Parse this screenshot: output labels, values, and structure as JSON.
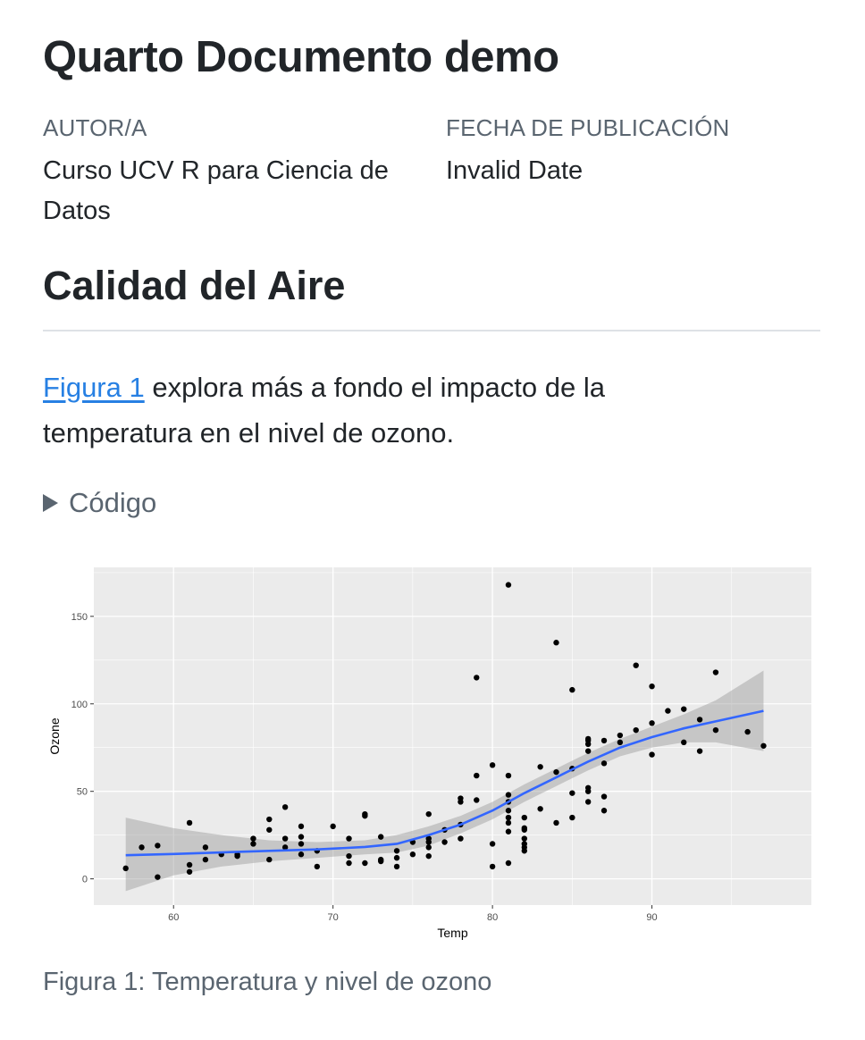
{
  "document": {
    "title": "Quarto Documento demo",
    "author_label": "AUTOR/A",
    "author": "Curso UCV R para Ciencia de Datos",
    "date_label": "FECHA DE PUBLICACIÓN",
    "date": "Invalid Date"
  },
  "section": {
    "title": "Calidad del Aire",
    "link_text": "Figura 1",
    "body_text": " explora más a fondo el impacto de la temperatura en el nivel de ozono.",
    "code_toggle": "Código"
  },
  "figure": {
    "caption": "Figura 1: Temperatura y nivel de ozono"
  },
  "colors": {
    "panel": "#ebebeb",
    "grid": "#ffffff",
    "points": "#000000",
    "smooth_line": "#3366ff",
    "ribbon": "#999999",
    "link": "#2780e3"
  },
  "chart_data": {
    "type": "scatter",
    "xlabel": "Temp",
    "ylabel": "Ozone",
    "xlim": [
      55,
      100
    ],
    "ylim": [
      -15,
      178
    ],
    "xticks": [
      60,
      70,
      80,
      90
    ],
    "yticks": [
      0,
      50,
      100,
      150
    ],
    "grid": true,
    "points": [
      [
        57,
        6
      ],
      [
        58,
        18
      ],
      [
        59,
        19
      ],
      [
        59,
        1
      ],
      [
        61,
        8
      ],
      [
        61,
        4
      ],
      [
        61,
        32
      ],
      [
        62,
        11
      ],
      [
        62,
        18
      ],
      [
        63,
        14
      ],
      [
        64,
        13
      ],
      [
        64,
        14
      ],
      [
        65,
        20
      ],
      [
        65,
        23
      ],
      [
        66,
        11
      ],
      [
        66,
        28
      ],
      [
        66,
        34
      ],
      [
        67,
        41
      ],
      [
        67,
        18
      ],
      [
        67,
        23
      ],
      [
        68,
        14
      ],
      [
        68,
        20
      ],
      [
        68,
        24
      ],
      [
        68,
        30
      ],
      [
        69,
        16
      ],
      [
        69,
        7
      ],
      [
        70,
        30
      ],
      [
        71,
        9
      ],
      [
        71,
        13
      ],
      [
        71,
        23
      ],
      [
        72,
        9
      ],
      [
        72,
        36
      ],
      [
        72,
        37
      ],
      [
        73,
        10
      ],
      [
        73,
        11
      ],
      [
        73,
        24
      ],
      [
        74,
        7
      ],
      [
        74,
        12
      ],
      [
        74,
        16
      ],
      [
        75,
        14
      ],
      [
        75,
        21
      ],
      [
        76,
        13
      ],
      [
        76,
        18
      ],
      [
        76,
        21
      ],
      [
        76,
        23
      ],
      [
        76,
        37
      ],
      [
        77,
        21
      ],
      [
        77,
        28
      ],
      [
        78,
        23
      ],
      [
        78,
        44
      ],
      [
        78,
        46
      ],
      [
        78,
        31
      ],
      [
        79,
        45
      ],
      [
        79,
        59
      ],
      [
        79,
        115
      ],
      [
        80,
        7
      ],
      [
        80,
        20
      ],
      [
        80,
        65
      ],
      [
        81,
        9
      ],
      [
        81,
        27
      ],
      [
        81,
        32
      ],
      [
        81,
        35
      ],
      [
        81,
        39
      ],
      [
        81,
        44
      ],
      [
        81,
        48
      ],
      [
        81,
        59
      ],
      [
        81,
        168
      ],
      [
        82,
        16
      ],
      [
        82,
        18
      ],
      [
        82,
        20
      ],
      [
        82,
        23
      ],
      [
        82,
        28
      ],
      [
        82,
        29
      ],
      [
        82,
        35
      ],
      [
        83,
        40
      ],
      [
        83,
        64
      ],
      [
        84,
        32
      ],
      [
        84,
        61
      ],
      [
        84,
        135
      ],
      [
        85,
        35
      ],
      [
        85,
        49
      ],
      [
        85,
        63
      ],
      [
        85,
        108
      ],
      [
        86,
        44
      ],
      [
        86,
        50
      ],
      [
        86,
        52
      ],
      [
        86,
        73
      ],
      [
        86,
        77
      ],
      [
        86,
        79
      ],
      [
        86,
        80
      ],
      [
        87,
        39
      ],
      [
        87,
        47
      ],
      [
        87,
        66
      ],
      [
        87,
        79
      ],
      [
        88,
        78
      ],
      [
        88,
        82
      ],
      [
        89,
        85
      ],
      [
        89,
        122
      ],
      [
        90,
        71
      ],
      [
        90,
        89
      ],
      [
        90,
        110
      ],
      [
        91,
        96
      ],
      [
        92,
        78
      ],
      [
        92,
        97
      ],
      [
        93,
        73
      ],
      [
        93,
        91
      ],
      [
        94,
        85
      ],
      [
        94,
        118
      ],
      [
        96,
        84
      ],
      [
        97,
        76
      ]
    ],
    "smooth": [
      [
        57,
        13.5
      ],
      [
        60,
        14.2
      ],
      [
        63,
        15.1
      ],
      [
        66,
        16.0
      ],
      [
        69,
        16.8
      ],
      [
        72,
        18.2
      ],
      [
        74,
        20.0
      ],
      [
        76,
        25.0
      ],
      [
        78,
        31.0
      ],
      [
        80,
        39.0
      ],
      [
        82,
        49.0
      ],
      [
        84,
        58.0
      ],
      [
        86,
        67.0
      ],
      [
        88,
        75.0
      ],
      [
        90,
        81.0
      ],
      [
        92,
        86.0
      ],
      [
        94,
        90.0
      ],
      [
        97,
        96.0
      ]
    ],
    "band_upper": [
      [
        57,
        35
      ],
      [
        60,
        29
      ],
      [
        63,
        25
      ],
      [
        66,
        22
      ],
      [
        69,
        21
      ],
      [
        72,
        22
      ],
      [
        74,
        25
      ],
      [
        76,
        30
      ],
      [
        78,
        36
      ],
      [
        80,
        44
      ],
      [
        82,
        54
      ],
      [
        84,
        63
      ],
      [
        86,
        72
      ],
      [
        88,
        80
      ],
      [
        90,
        87
      ],
      [
        92,
        94
      ],
      [
        94,
        102
      ],
      [
        97,
        119
      ]
    ],
    "band_lower": [
      [
        57,
        -7
      ],
      [
        60,
        2
      ],
      [
        63,
        7
      ],
      [
        66,
        10
      ],
      [
        69,
        12
      ],
      [
        72,
        14
      ],
      [
        74,
        15
      ],
      [
        76,
        19
      ],
      [
        78,
        26
      ],
      [
        80,
        34
      ],
      [
        82,
        44
      ],
      [
        84,
        53
      ],
      [
        86,
        62
      ],
      [
        88,
        70
      ],
      [
        90,
        75
      ],
      [
        92,
        78
      ],
      [
        94,
        78
      ],
      [
        97,
        73
      ]
    ]
  }
}
